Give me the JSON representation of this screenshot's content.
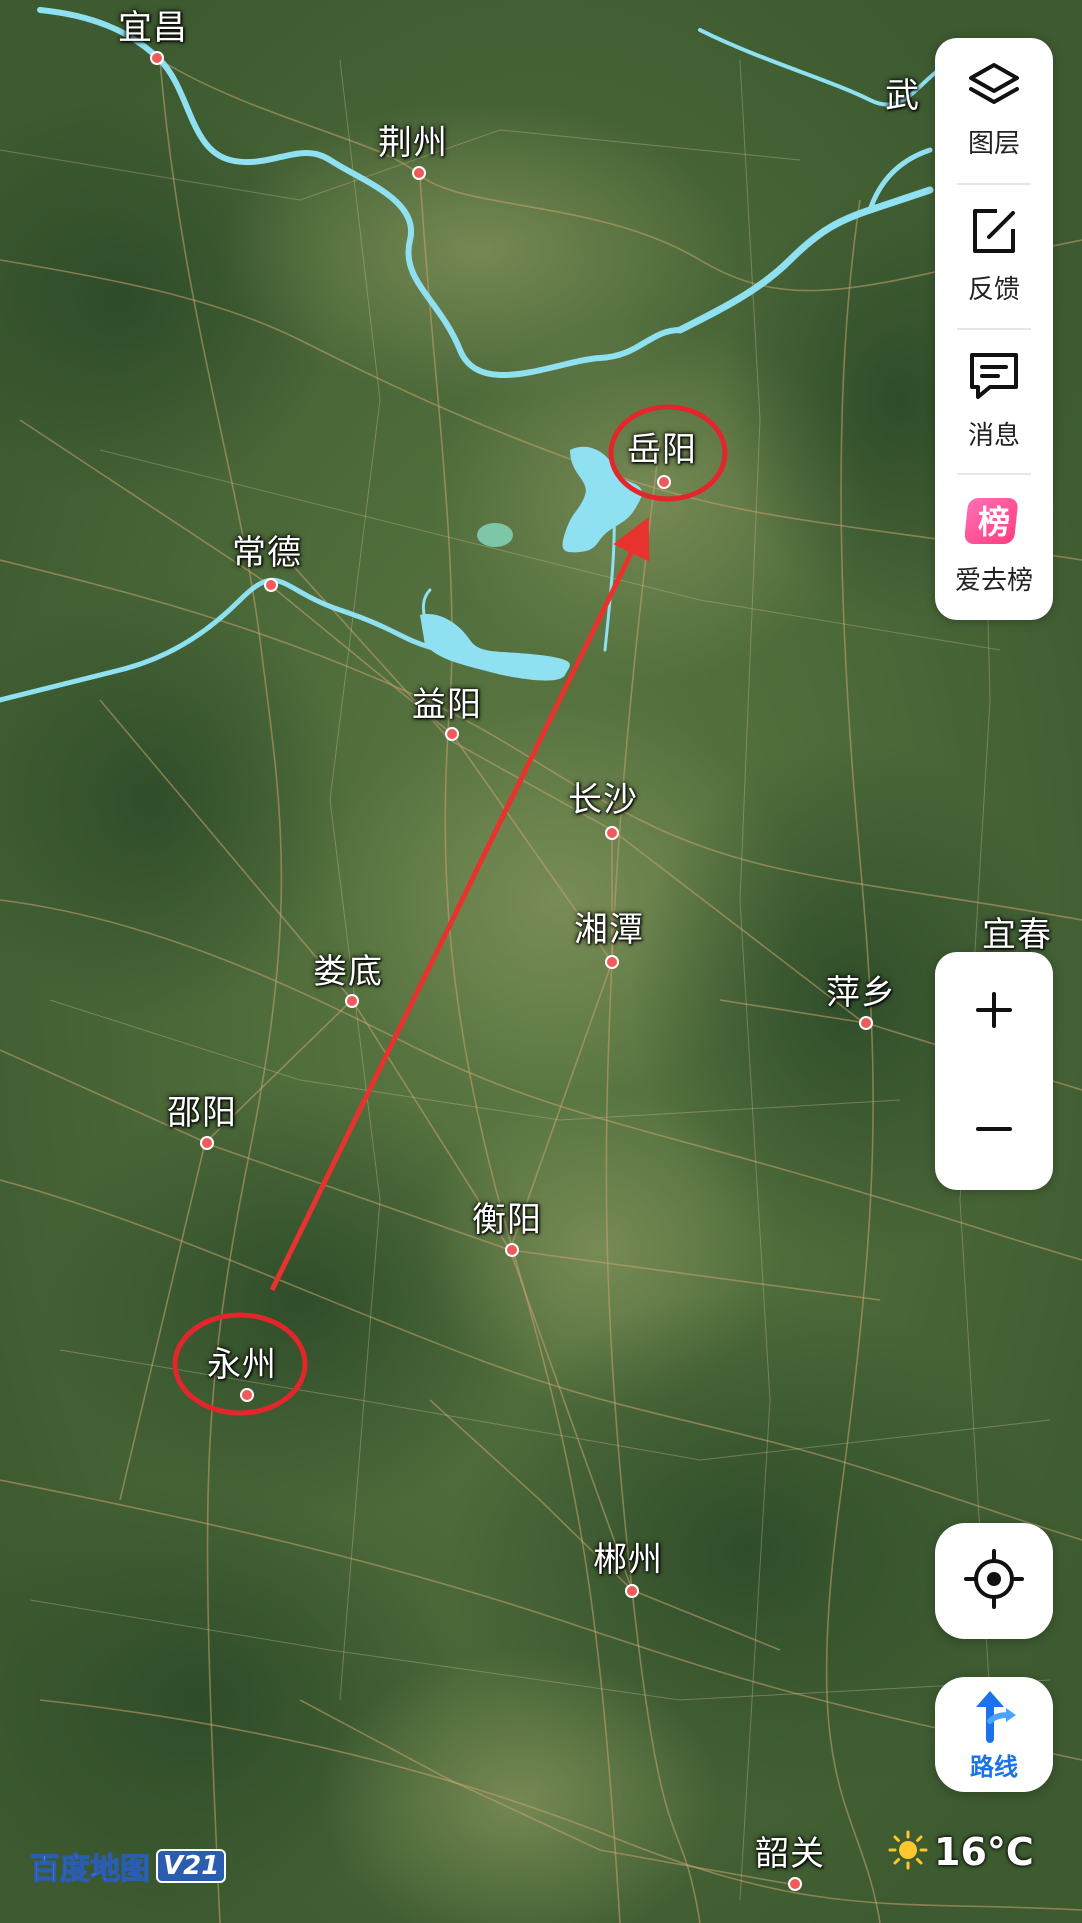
{
  "map": {
    "cities": [
      {
        "name": "宜昌"
      },
      {
        "name": "荆州"
      },
      {
        "name": "武"
      },
      {
        "name": "岳阳"
      },
      {
        "name": "常德"
      },
      {
        "name": "益阳"
      },
      {
        "name": "长沙"
      },
      {
        "name": "湘潭"
      },
      {
        "name": "宜春"
      },
      {
        "name": "萍乡"
      },
      {
        "name": "娄底"
      },
      {
        "name": "邵阳"
      },
      {
        "name": "衡阳"
      },
      {
        "name": "永州"
      },
      {
        "name": "郴州"
      },
      {
        "name": "韶关"
      }
    ],
    "highlighted": [
      "岳阳",
      "永州"
    ],
    "route_line": {
      "from": "永州",
      "to": "岳阳",
      "color": "#e8322e"
    },
    "circle_color": "#e3262b",
    "water_color": "#8fe0f0"
  },
  "side_panel": {
    "items": [
      {
        "label": "图层",
        "icon": "layers-icon"
      },
      {
        "label": "反馈",
        "icon": "feedback-edit-icon"
      },
      {
        "label": "消息",
        "icon": "message-icon"
      },
      {
        "label": "爱去榜",
        "icon": "ranking-badge-icon",
        "badge": "榜"
      }
    ]
  },
  "zoom": {
    "in_label": "+",
    "out_label": "−"
  },
  "locate": {
    "icon": "locate-crosshair-icon"
  },
  "route_button": {
    "label": "路线",
    "icon": "route-arrow-icon"
  },
  "logo": {
    "text": "百度地图",
    "version": "V21"
  },
  "weather": {
    "icon": "sun-icon",
    "temperature": "16°C"
  }
}
